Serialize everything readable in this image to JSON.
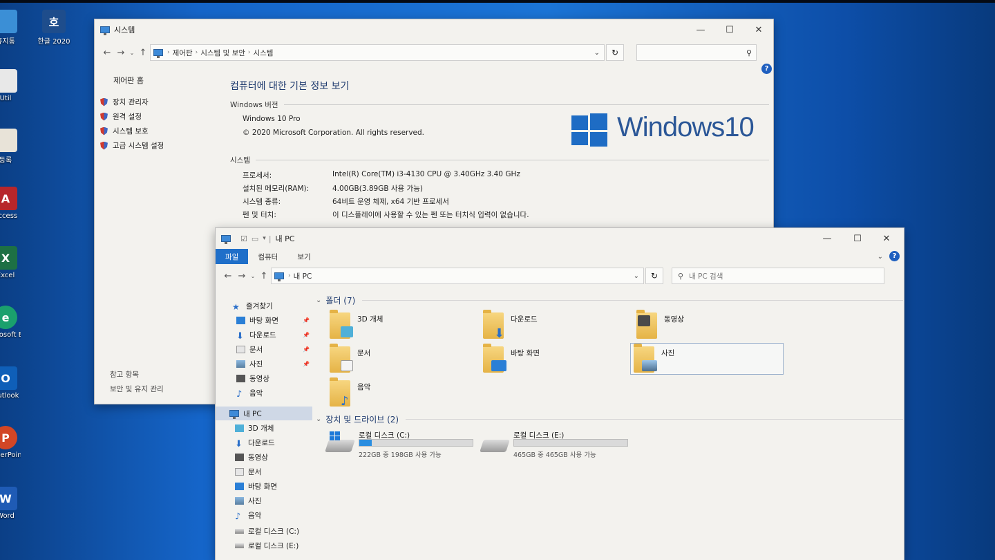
{
  "desktop": {
    "icons": [
      {
        "label": "휴지통"
      },
      {
        "label": "한글 2020",
        "glyph": "호"
      },
      {
        "label": "Util"
      },
      {
        "label": "등록"
      },
      {
        "label": "Access",
        "glyph": "A"
      },
      {
        "label": "Excel",
        "glyph": "X"
      },
      {
        "label": "Microsoft Edge",
        "glyph": "e"
      },
      {
        "label": "Outlook",
        "glyph": "O"
      },
      {
        "label": "PowerPoint",
        "glyph": "P"
      },
      {
        "label": "Word",
        "glyph": "W"
      }
    ]
  },
  "system_window": {
    "title": "시스템",
    "breadcrumbs": [
      "제어판",
      "시스템 및 보안",
      "시스템"
    ],
    "left_pane": {
      "home": "제어판 홈",
      "links": [
        "장치 관리자",
        "원격 설정",
        "시스템 보호",
        "고급 시스템 설정"
      ],
      "see_also": "참고 항목",
      "see_also_link": "보안 및 유지 관리"
    },
    "heading": "컴퓨터에 대한 기본 정보 보기",
    "edition_section": "Windows 버전",
    "edition": "Windows 10 Pro",
    "copyright": "© 2020 Microsoft Corporation. All rights reserved.",
    "logo_text": "Windows10",
    "system_section": "시스템",
    "specs": [
      {
        "label": "프로세서:",
        "value": "Intel(R) Core(TM) i3-4130 CPU @ 3.40GHz   3.40 GHz"
      },
      {
        "label": "설치된 메모리(RAM):",
        "value": "4.00GB(3.89GB 사용 가능)"
      },
      {
        "label": "시스템 종류:",
        "value": "64비트 운영 체제, x64 기반 프로세서"
      },
      {
        "label": "펜 및 터치:",
        "value": "이 디스플레이에 사용할 수 있는 펜 또는 터치식 입력이 없습니다."
      }
    ],
    "help": "?",
    "colors": {
      "heading": "#1e3a6e",
      "logo": "#1e6cc4"
    }
  },
  "explorer_window": {
    "title": "내 PC",
    "tabs": [
      "파일",
      "컴퓨터",
      "보기"
    ],
    "address": "내 PC",
    "search_placeholder": "내 PC 검색",
    "help": "?",
    "nav": {
      "quick_access": "즐겨찾기",
      "quick_items": [
        "바탕 화면",
        "다운로드",
        "문서",
        "사진",
        "동영상",
        "음악"
      ],
      "this_pc": "내 PC",
      "pc_items": [
        "3D 개체",
        "다운로드",
        "동영상",
        "문서",
        "바탕 화면",
        "사진",
        "음악",
        "로컬 디스크 (C:)",
        "로컬 디스크 (E:)"
      ]
    },
    "folders_group": "폴더 (7)",
    "folders": [
      "3D 개체",
      "다운로드",
      "동영상",
      "문서",
      "바탕 화면",
      "사진",
      "음악"
    ],
    "drives_group": "장치 및 드라이브 (2)",
    "drives": [
      {
        "name": "로컬 디스크 (C:)",
        "free_text": "222GB 중 198GB 사용 가능",
        "used_fraction": 0.11
      },
      {
        "name": "로컬 디스크 (E:)",
        "free_text": "465GB 중 465GB 사용 가능",
        "used_fraction": 0.0
      }
    ],
    "colors": {
      "accent": "#1f6fc9",
      "group": "#1e3a6e"
    }
  }
}
